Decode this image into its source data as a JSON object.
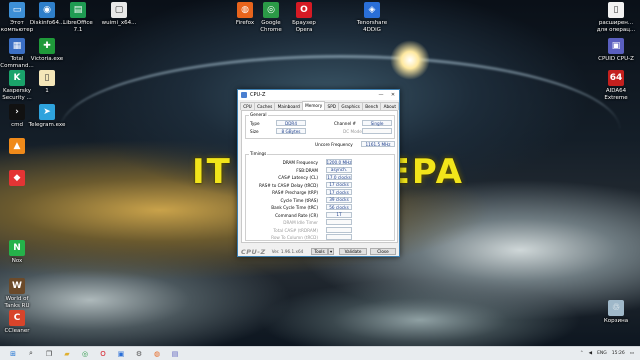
{
  "banner": {
    "left": "IT",
    "right": "EPA"
  },
  "desktop_icons": [
    {
      "label": "Этот\nкомпьютер",
      "icon": "computer-icon",
      "color": "#3d8fd6",
      "glyph": "▭"
    },
    {
      "label": "Diskinfo64...",
      "icon": "disk-icon",
      "color": "#2f7fc9",
      "glyph": "◉"
    },
    {
      "label": "LibreOffice\n7.1",
      "icon": "libreoffice-icon",
      "color": "#1f9b52",
      "glyph": "▤"
    },
    {
      "label": "wuimi_x64...",
      "icon": "window-icon",
      "color": "#e8e8e8",
      "glyph": "▢"
    },
    {
      "label": "Firefox",
      "icon": "firefox-icon",
      "color": "#e8641c",
      "glyph": "◍"
    },
    {
      "label": "Google\nChrome",
      "icon": "chrome-icon",
      "color": "#2b9a47",
      "glyph": "◎"
    },
    {
      "label": "Браузер\nOpera",
      "icon": "opera-icon",
      "color": "#d61a24",
      "glyph": "O"
    },
    {
      "label": "Tenorshare\n4DDiG",
      "icon": "tenorshare-icon",
      "color": "#2a6fd8",
      "glyph": "◈"
    },
    {
      "label": "расширен...\nдля операц...",
      "icon": "document-icon",
      "color": "#f2f2f2",
      "glyph": "▯"
    },
    {
      "label": "Total\nCommand...",
      "icon": "totalcommander-icon",
      "color": "#3b6fc4",
      "glyph": "▦"
    },
    {
      "label": "Victoria.exe",
      "icon": "victoria-icon",
      "color": "#1f9a3a",
      "glyph": "✚"
    },
    {
      "label": "CPUID CPU-Z",
      "icon": "cpuz-icon",
      "color": "#5a5fbf",
      "glyph": "▣"
    },
    {
      "label": "Kaspersky\nSecurity ...",
      "icon": "kaspersky-icon",
      "color": "#1aa36a",
      "glyph": "K"
    },
    {
      "label": "1",
      "icon": "text-file-icon",
      "color": "#f4e6b8",
      "glyph": "▯"
    },
    {
      "label": "AIDA64\nExtreme",
      "icon": "aida64-icon",
      "color": "#c4201e",
      "glyph": "64"
    },
    {
      "label": "cmd",
      "icon": "cmd-icon",
      "color": "#111111",
      "glyph": "›"
    },
    {
      "label": "Telegram.exe",
      "icon": "telegram-icon",
      "color": "#2ea3dd",
      "glyph": "➤"
    },
    {
      "label": "",
      "icon": "vlc-icon",
      "color": "#f08a1a",
      "glyph": "▲"
    },
    {
      "label": "",
      "icon": "program-icon",
      "color": "#e43434",
      "glyph": "◆"
    },
    {
      "label": "Nox",
      "icon": "nox-icon",
      "color": "#25b24a",
      "glyph": "N"
    },
    {
      "label": "World of\nTanks RU",
      "icon": "wot-icon",
      "color": "#6b4a2a",
      "glyph": "W"
    },
    {
      "label": "CCleaner",
      "icon": "ccleaner-icon",
      "color": "#d8442a",
      "glyph": "C"
    },
    {
      "label": "Корзина",
      "icon": "recycle-bin-icon",
      "color": "#9fb8c9",
      "glyph": "♲"
    }
  ],
  "cpuz": {
    "title": "CPU-Z",
    "tabs": [
      "CPU",
      "Caches",
      "Mainboard",
      "Memory",
      "SPD",
      "Graphics",
      "Bench",
      "About"
    ],
    "active_tab": "Memory",
    "general": {
      "title": "General",
      "type_label": "Type",
      "type_value": "DDR4",
      "size_label": "Size",
      "size_value": "8 GBytes",
      "channel_label": "Channel #",
      "channel_value": "Single",
      "dcmode_label": "DC Mode",
      "dcmode_value": "",
      "uncore_label": "Uncore Frequency",
      "uncore_value": "1161.5 MHz"
    },
    "timings": {
      "title": "Timings",
      "rows": [
        {
          "label": "DRAM Frequency",
          "value": "1200.0 MHz",
          "dim": false
        },
        {
          "label": "FSB:DRAM",
          "value": "asynch.",
          "dim": false
        },
        {
          "label": "CAS# Latency (CL)",
          "value": "17.0 clocks",
          "dim": false
        },
        {
          "label": "RAS# to CAS# Delay (tRCD)",
          "value": "17 clocks",
          "dim": false
        },
        {
          "label": "RAS# Precharge (tRP)",
          "value": "17 clocks",
          "dim": false
        },
        {
          "label": "Cycle Time (tRAS)",
          "value": "39 clocks",
          "dim": false
        },
        {
          "label": "Bank Cycle Time (tRC)",
          "value": "56 clocks",
          "dim": false
        },
        {
          "label": "Command Rate (CR)",
          "value": "1T",
          "dim": false
        },
        {
          "label": "DRAM Idle Timer",
          "value": "",
          "dim": true
        },
        {
          "label": "Total CAS# (tRDRAM)",
          "value": "",
          "dim": true
        },
        {
          "label": "Row To Column (tRCD)",
          "value": "",
          "dim": true
        }
      ]
    },
    "footer": {
      "logo": "CPU-Z",
      "version": "Ver. 1.96.1.x64",
      "tools_label": "Tools",
      "validate_label": "Validate",
      "close_label": "Close"
    }
  },
  "tray": {
    "lang": "ENG",
    "time": "15:26"
  },
  "taskbar_icons": [
    "windows-start-icon",
    "search-icon",
    "task-view-icon",
    "explorer-icon",
    "chrome-icon",
    "opera-icon",
    "store-icon",
    "settings-icon",
    "firefox-icon",
    "cpuz-icon"
  ]
}
